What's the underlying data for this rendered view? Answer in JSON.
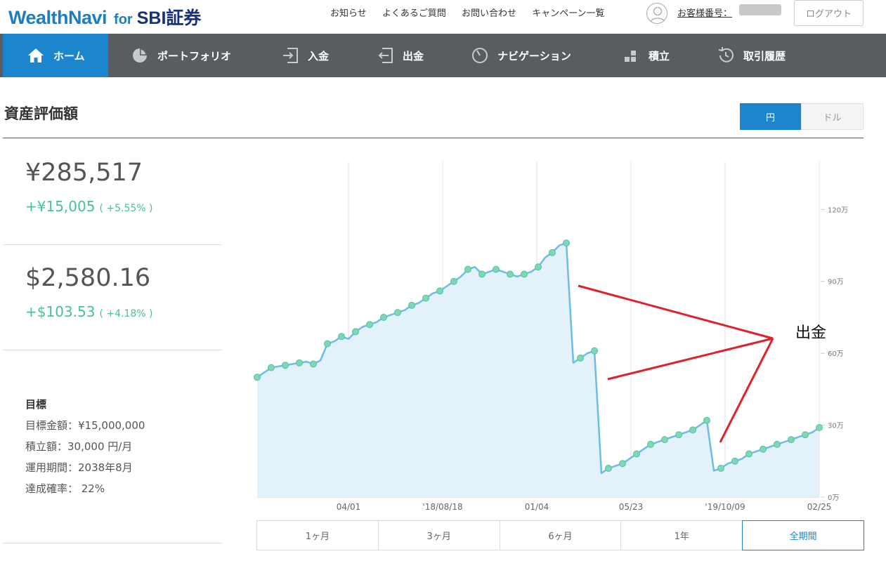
{
  "header": {
    "logo_main": "WealthNavi",
    "logo_for": "for",
    "logo_partner": "SBI証券",
    "links": [
      "お知らせ",
      "よくあるご質問",
      "お問い合わせ",
      "キャンペーン一覧"
    ],
    "customer_label": "お客様番号：",
    "logout_label": "ログアウト"
  },
  "nav": {
    "items": [
      {
        "label": "ホーム",
        "icon": "home-icon"
      },
      {
        "label": "ポートフォリオ",
        "icon": "pie-chart-icon"
      },
      {
        "label": "入金",
        "icon": "deposit-icon"
      },
      {
        "label": "出金",
        "icon": "withdraw-icon"
      },
      {
        "label": "ナビゲーション",
        "icon": "gauge-icon"
      },
      {
        "label": "積立",
        "icon": "blocks-icon"
      },
      {
        "label": "取引履歴",
        "icon": "history-icon"
      }
    ],
    "active_index": 0,
    "bg_color": "#595d61",
    "active_color": "#1b85cd"
  },
  "section": {
    "title": "資産評価額",
    "currency_yen": "円",
    "currency_usd": "ドル"
  },
  "summary": {
    "yen_value": "¥285,517",
    "yen_change": "+¥15,005",
    "yen_change_pct": "( +5.55% )",
    "usd_value": "$2,580.16",
    "usd_change": "+$103.53",
    "usd_change_pct": "( +4.18% )",
    "positive_color": "#45c299"
  },
  "goal": {
    "title": "目標",
    "rows": [
      "目標金額：¥15,000,000",
      "積立額：30,000 円/月",
      "運用期間：2038年8月",
      "達成確率： 22%"
    ]
  },
  "annotation": {
    "label": "出金",
    "color": "#e0202a"
  },
  "periods": {
    "items": [
      "1ヶ月",
      "3ヶ月",
      "6ヶ月",
      "1年",
      "全期間"
    ],
    "active_index": 4
  },
  "chart_data": {
    "type": "area",
    "x_tick_labels": [
      "04/01",
      "'18/08/18",
      "01/04",
      "05/23",
      "'19/10/09",
      "02/25"
    ],
    "y_tick_labels": [
      "0万",
      "30万",
      "60万",
      "90万",
      "120万"
    ],
    "ylim": [
      0,
      1400000
    ],
    "grid": "vertical",
    "series": [
      {
        "line_color": "#6bbde8",
        "fill_color": "#e3f1fa",
        "values": [
          500000,
          520000,
          540000,
          545000,
          550000,
          555000,
          560000,
          565000,
          555000,
          570000,
          640000,
          650000,
          670000,
          660000,
          690000,
          710000,
          720000,
          730000,
          750000,
          760000,
          770000,
          780000,
          800000,
          810000,
          830000,
          850000,
          860000,
          880000,
          900000,
          920000,
          950000,
          960000,
          930000,
          940000,
          950000,
          940000,
          930000,
          920000,
          930000,
          940000,
          960000,
          1000000,
          1020000,
          1050000,
          1060000,
          560000,
          580000,
          600000,
          610000,
          100000,
          120000,
          130000,
          140000,
          160000,
          180000,
          200000,
          220000,
          230000,
          240000,
          250000,
          260000,
          270000,
          280000,
          300000,
          320000,
          110000,
          120000,
          140000,
          150000,
          160000,
          180000,
          190000,
          200000,
          210000,
          220000,
          230000,
          240000,
          250000,
          260000,
          270000,
          290000
        ]
      }
    ]
  }
}
